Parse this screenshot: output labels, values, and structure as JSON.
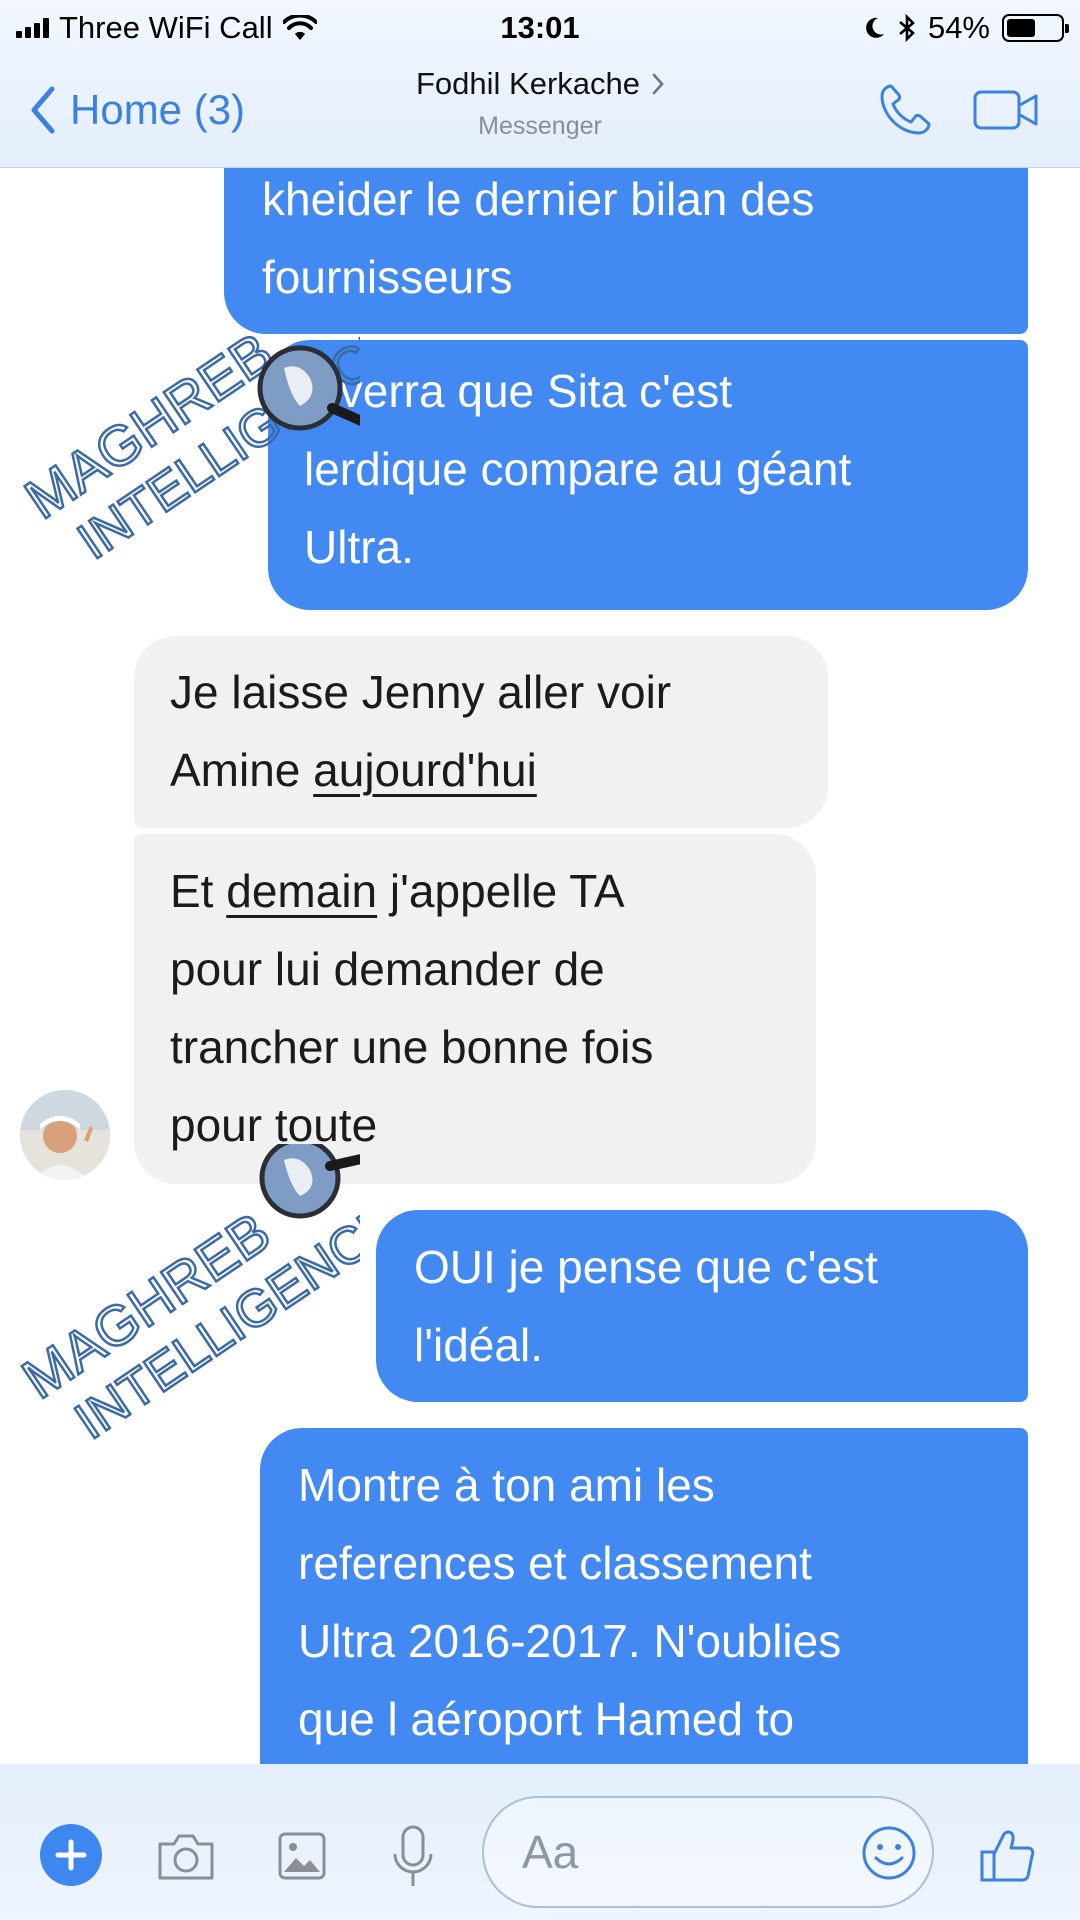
{
  "status_bar": {
    "carrier": "Three WiFi Call",
    "time": "13:01",
    "battery_percent_label": "54%",
    "battery_level": 0.54
  },
  "nav": {
    "back_label": "Home (3)",
    "contact_name": "Fodhil Kerkache",
    "subtitle": "Messenger"
  },
  "messages": [
    {
      "direction": "outgoing",
      "lines": [
        "kheider le dernier bilan des",
        "fournisseurs"
      ]
    },
    {
      "direction": "outgoing",
      "lines": [
        "Il verra que Sita c'est",
        "lerdique compare au géant",
        "Ultra."
      ]
    },
    {
      "direction": "incoming",
      "lines": [
        "Je laisse Jenny aller voir",
        "Amine aujourd'hui"
      ]
    },
    {
      "direction": "incoming",
      "lines": [
        "Et demain j'appelle TA",
        "pour lui demander de",
        "trancher une bonne fois",
        "pour toute"
      ]
    },
    {
      "direction": "outgoing",
      "lines": [
        "OUI je pense que c'est",
        "l'idéal."
      ]
    },
    {
      "direction": "outgoing",
      "lines": [
        "Montre à ton ami les",
        "references et classement",
        "Ultra 2016-2017. N'oublies",
        "que l aéroport Hamed to"
      ]
    }
  ],
  "msg_parts": {
    "m3_line2_pre": "Amine ",
    "m3_line2_u": "aujourd'hui",
    "m4_line1_pre": "Et ",
    "m4_line1_u": "demain",
    "m4_line1_post": " j'appelle TA"
  },
  "watermark": {
    "line1": "MAGHREB",
    "line2": "INTELLIGENCE"
  },
  "composer": {
    "placeholder": "Aa"
  },
  "colors": {
    "accent": "#3b82e0",
    "outgoing_bubble": "#4289f2",
    "incoming_bubble": "#f1f1f1",
    "watermark": "#3b6aa8"
  },
  "icons": {
    "back": "chevron-left-icon",
    "phone": "phone-icon",
    "video": "video-camera-icon",
    "plus": "plus-icon",
    "camera": "camera-icon",
    "image": "image-icon",
    "mic": "microphone-icon",
    "emoji": "emoji-icon",
    "like": "thumbs-up-icon"
  }
}
